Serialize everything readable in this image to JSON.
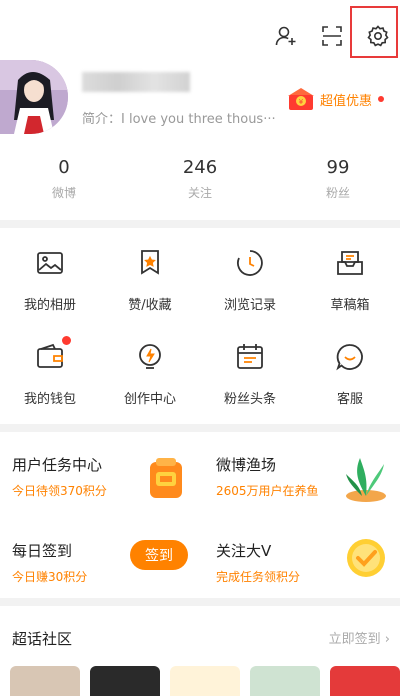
{
  "profile": {
    "bio": "简介：I love you three thous···",
    "promo_label": "超值优惠"
  },
  "stats": [
    {
      "value": "0",
      "label": "微博"
    },
    {
      "value": "246",
      "label": "关注"
    },
    {
      "value": "99",
      "label": "粉丝"
    }
  ],
  "grid": {
    "items": [
      {
        "label": "我的相册",
        "icon": "photo-album-icon"
      },
      {
        "label": "赞/收藏",
        "icon": "favorite-icon"
      },
      {
        "label": "浏览记录",
        "icon": "history-icon"
      },
      {
        "label": "草稿箱",
        "icon": "drafts-icon"
      },
      {
        "label": "我的钱包",
        "icon": "wallet-icon"
      },
      {
        "label": "创作中心",
        "icon": "creator-icon"
      },
      {
        "label": "粉丝头条",
        "icon": "calendar-icon"
      },
      {
        "label": "客服",
        "icon": "customer-service-icon"
      }
    ]
  },
  "tasks": [
    {
      "title": "用户任务中心",
      "sub": "今日待领370积分"
    },
    {
      "title": "微博渔场",
      "sub": "2605万用户在养鱼"
    },
    {
      "title": "每日签到",
      "sub": "今日赚30积分",
      "button": "签到"
    },
    {
      "title": "关注大V",
      "sub": "完成任务领积分"
    }
  ],
  "topic": {
    "title": "超话社区",
    "link": "立即签到 ›"
  },
  "colors": {
    "accent": "#ff8200",
    "highlight_box": "#e83a3a",
    "badge": "#ff3b30"
  }
}
